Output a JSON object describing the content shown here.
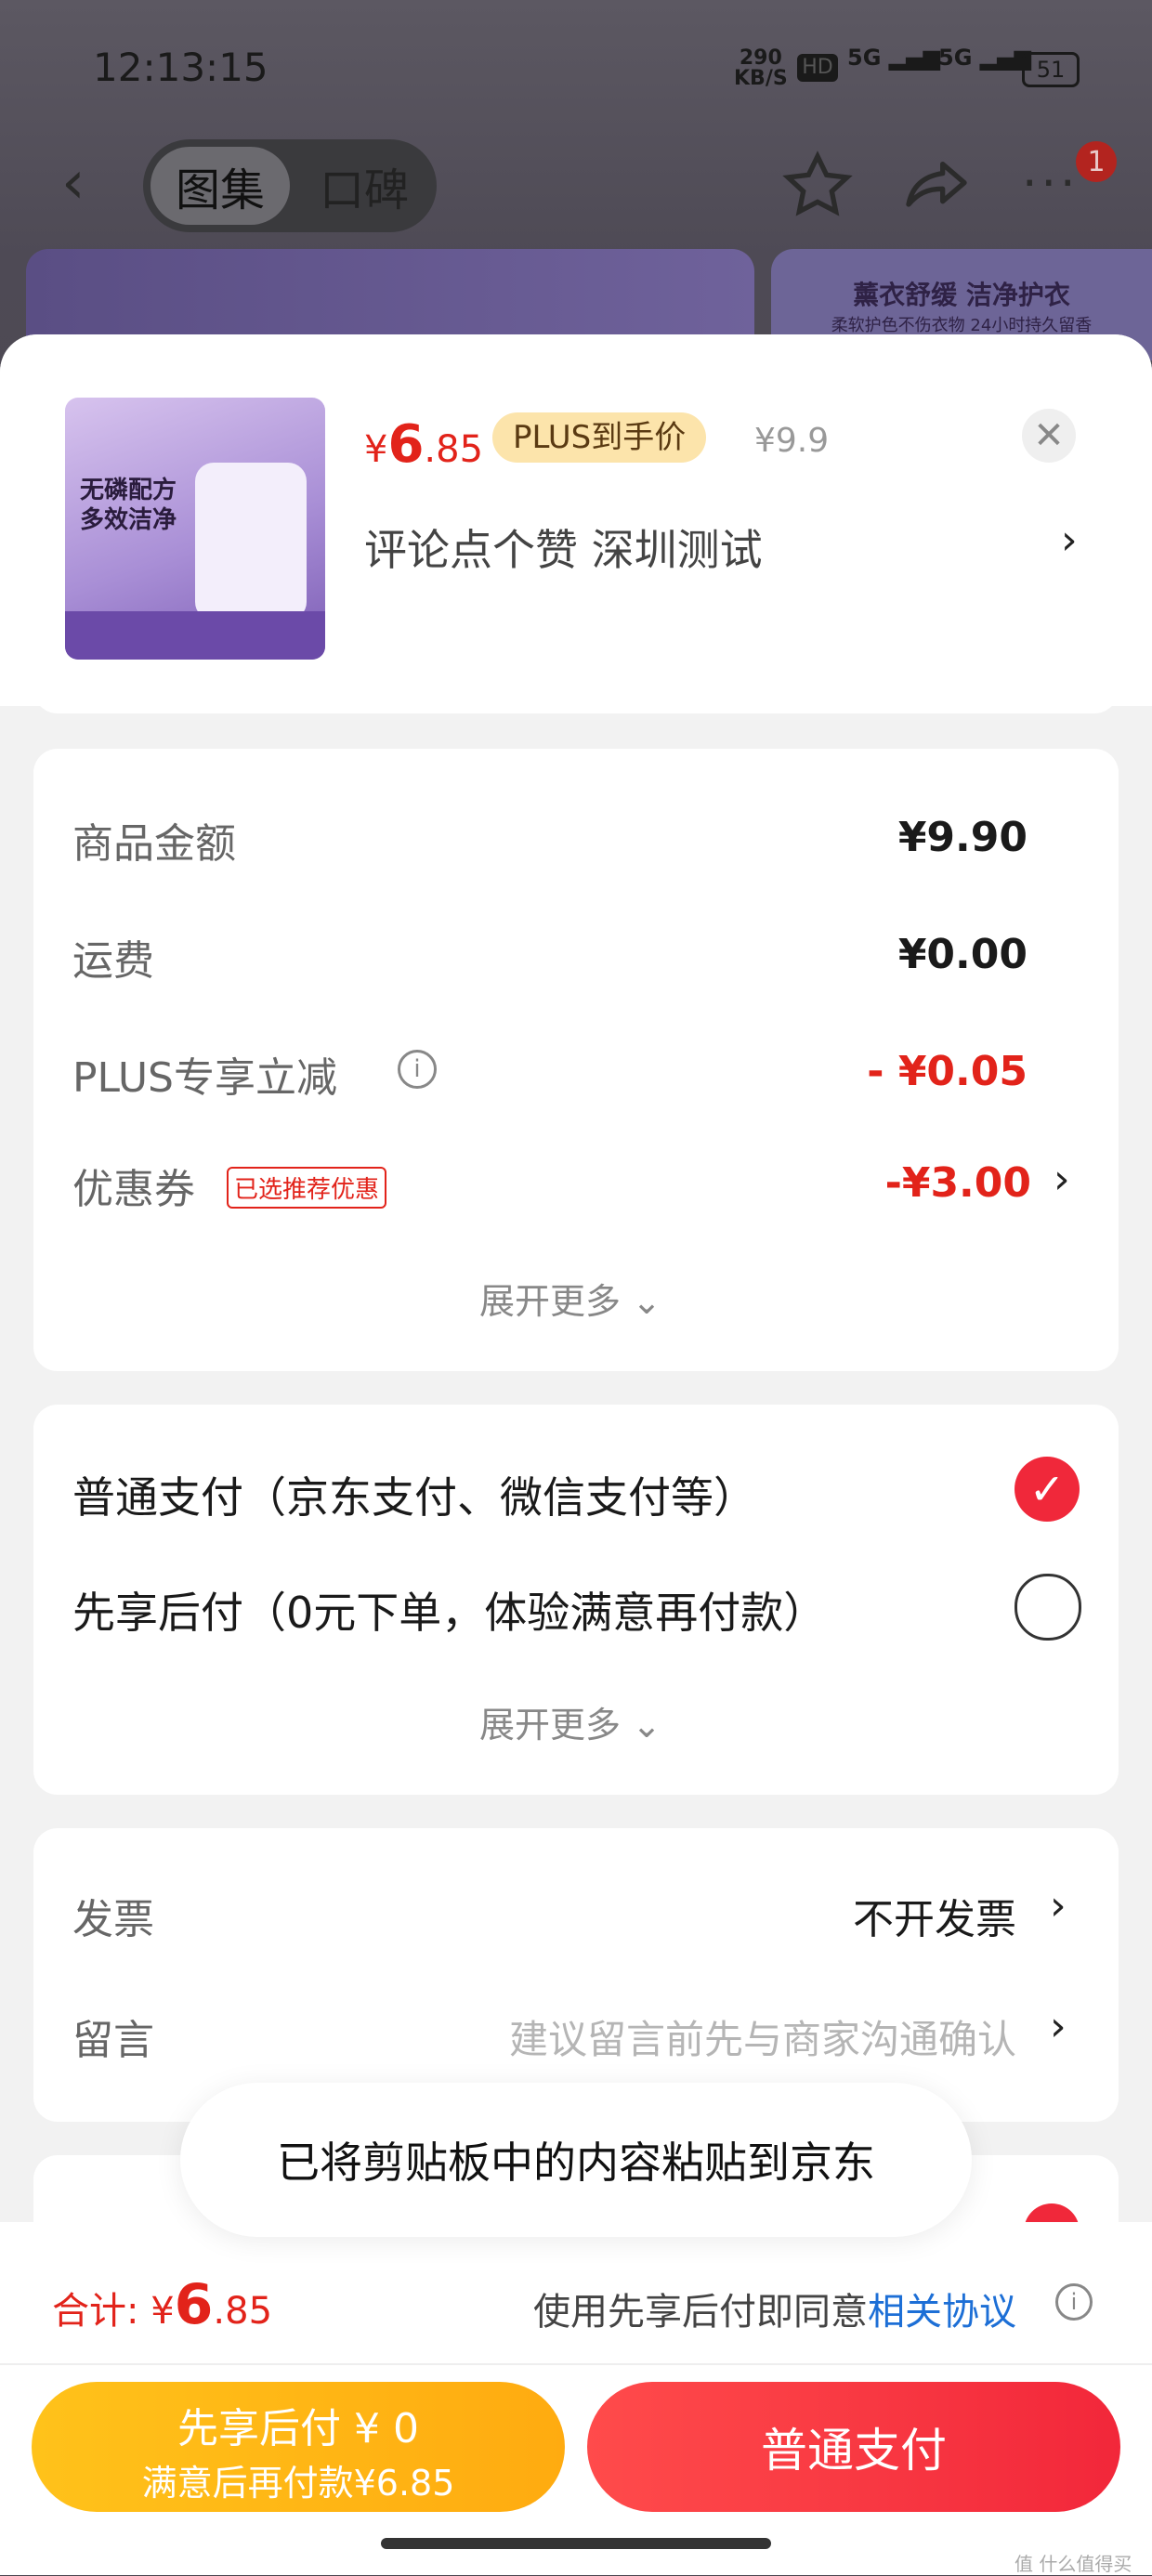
{
  "status_bar": {
    "time": "12:13:15",
    "net_speed_value": "290",
    "net_speed_unit": "KB/S",
    "hd": "HD",
    "sig1": "5G",
    "sig2": "5G",
    "battery": "51"
  },
  "nav": {
    "tab_gallery": "图集",
    "tab_reviews": "口碑",
    "badge_count": "1"
  },
  "bg_banner": {
    "line1": "薰衣舒缓 洁净护衣",
    "line2": "柔软护色不伤衣物 24小时持久留香"
  },
  "product": {
    "image_line1": "无磷配方",
    "image_line2": "多效洁净",
    "price_symbol": "¥",
    "price_int": "6",
    "price_dec": ".85",
    "plus_tag": "PLUS到手价",
    "original_price": "¥9.9",
    "spec": "评论点个赞  深圳测试"
  },
  "amounts": {
    "rows": [
      {
        "label": "商品金额",
        "value": "¥9.90"
      },
      {
        "label": "运费",
        "value": "¥0.00"
      },
      {
        "label": "PLUS专享立减",
        "value": "- ¥0.05"
      },
      {
        "label": "优惠券",
        "tag": "已选推荐优惠",
        "value": "-¥3.00"
      }
    ],
    "expand": "展开更多"
  },
  "payment": {
    "options": [
      {
        "label": "普通支付（京东支付、微信支付等）",
        "selected": true
      },
      {
        "label": "先享后付（0元下单，体验满意再付款）",
        "selected": false
      }
    ],
    "expand": "展开更多"
  },
  "extras": {
    "invoice_label": "发票",
    "invoice_value": "不开发票",
    "message_label": "留言",
    "message_placeholder": "建议留言前先与商家沟通确认"
  },
  "toast": "已将剪贴板中的内容粘贴到京东",
  "footer": {
    "total_label": "合计:",
    "total_symbol": "¥",
    "total_int": "6",
    "total_dec": ".85",
    "agree_text": "使用先享后付即同意",
    "agree_link": "相关协议",
    "btn_later_line1": "先享后付 ¥ 0",
    "btn_later_line2": "满意后再付款¥6.85",
    "btn_pay": "普通支付"
  },
  "watermark": "值 什么值得买"
}
